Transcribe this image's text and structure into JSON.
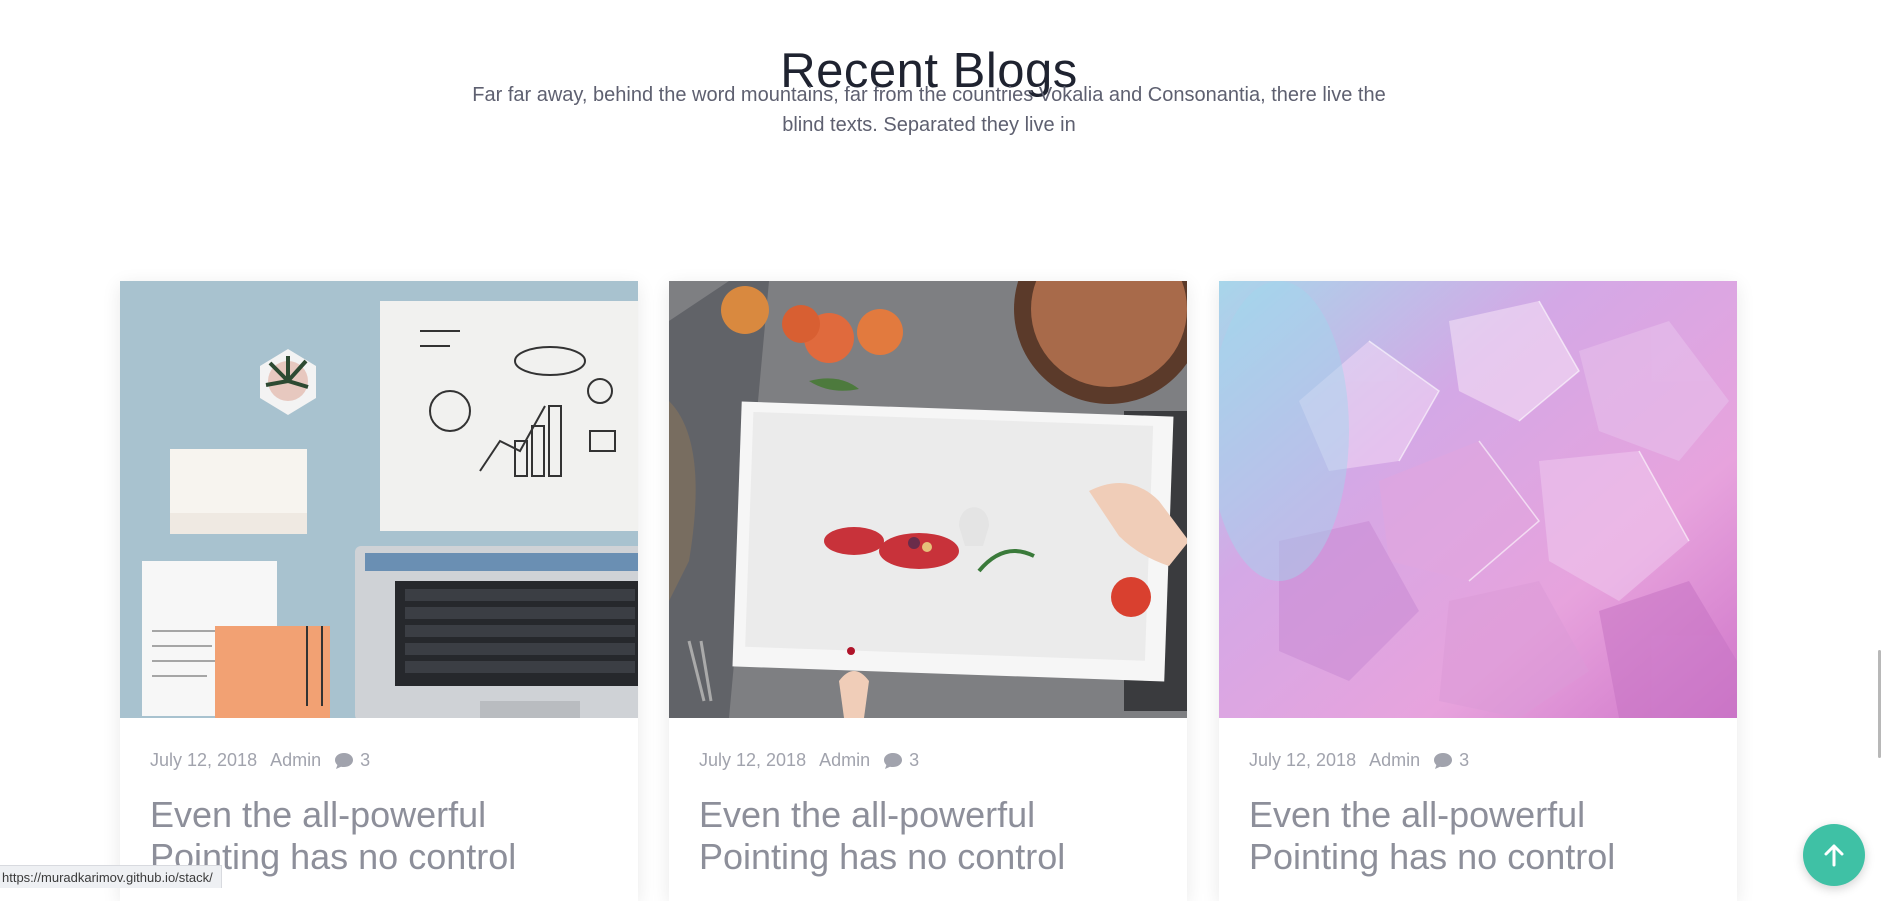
{
  "section": {
    "heading": "Recent Blogs",
    "subtitle": "Far far away, behind the word mountains, far from the countries Vokalia and Consonantia, there live the blind texts. Separated they live in"
  },
  "posts": [
    {
      "image": "desk-workspace-photo",
      "date": "July 12, 2018",
      "author": "Admin",
      "comments": "3",
      "title": "Even the all-powerful Pointing has no control"
    },
    {
      "image": "pie-photo-print",
      "date": "July 12, 2018",
      "author": "Admin",
      "comments": "3",
      "title": "Even the all-powerful Pointing has no control"
    },
    {
      "image": "pink-crystal-macro",
      "date": "July 12, 2018",
      "author": "Admin",
      "comments": "3",
      "title": "Even the all-powerful Pointing has no control"
    }
  ],
  "status_bar": {
    "url": "https://muradkarimov.github.io/stack/"
  },
  "icons": {
    "comment": "chat-bubble-icon",
    "back_to_top": "arrow-up-icon"
  },
  "colors": {
    "accent": "#3fc1a5",
    "heading": "#1f2330",
    "meta": "#a1a3ad",
    "title": "#8d8f9a"
  }
}
